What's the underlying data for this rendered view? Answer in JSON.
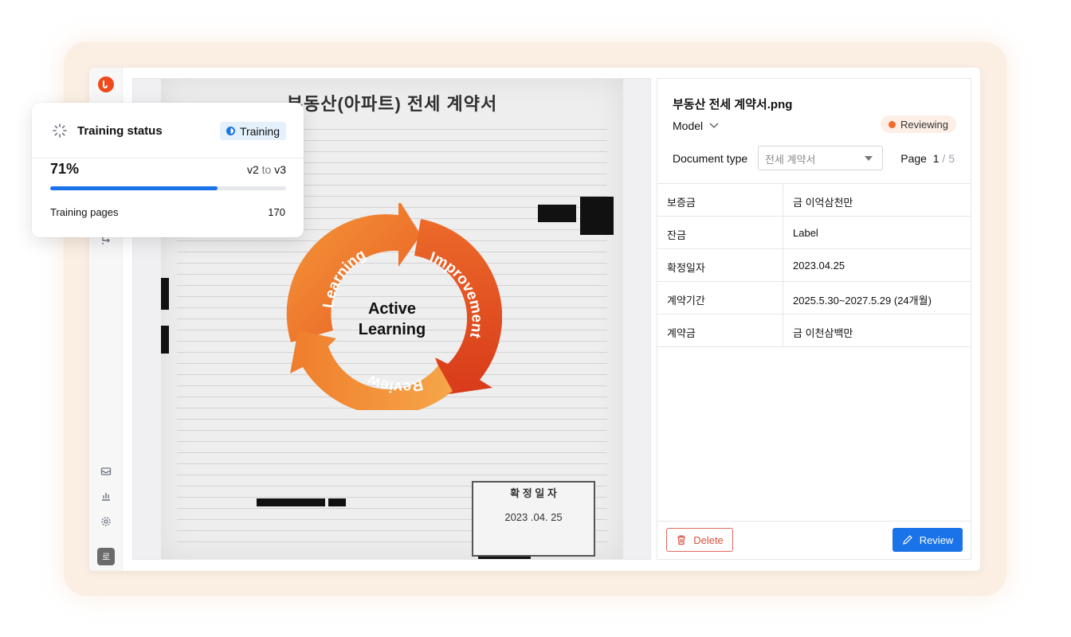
{
  "document": {
    "title": "부동산(아파트) 전세 계약서",
    "stamp_title": "확 정 일 자",
    "stamp_date": "2023 .04. 25"
  },
  "cycle": {
    "center_line1": "Active",
    "center_line2": "Learning",
    "labels": [
      "Learning",
      "Improvement",
      "Review"
    ],
    "colors": {
      "orange": "#f08a2c",
      "red": "#e8451e"
    }
  },
  "panel": {
    "file_name": "부동산 전세 계약서.png",
    "model_label": "Model",
    "status": "Reviewing",
    "status_color": "#f26b2a",
    "doctype_label": "Document type",
    "doctype_value": "전세 계약서",
    "page_label": "Page",
    "page_current": "1",
    "page_sep": "/",
    "page_total": "5",
    "fields": [
      {
        "key": "보증금",
        "value": "금 이억삼천만"
      },
      {
        "key": "잔금",
        "value": "Label"
      },
      {
        "key": "확정일자",
        "value": "2023.04.25"
      },
      {
        "key": "계약기간",
        "value": "2025.5.30~2027.5.29 (24개월)"
      },
      {
        "key": "계약금",
        "value": "금 이천삼백만"
      }
    ],
    "delete_label": "Delete",
    "review_label": "Review"
  },
  "training": {
    "title": "Training status",
    "badge": "Training",
    "percent_text": "71%",
    "progress": 0.71,
    "version_from": "v2",
    "version_to_word": "to",
    "version_to": "v3",
    "pages_label": "Training pages",
    "pages_value": "170"
  },
  "sidebar": {
    "avatar_initial": "로",
    "brand_color": "#ee4a1c"
  }
}
